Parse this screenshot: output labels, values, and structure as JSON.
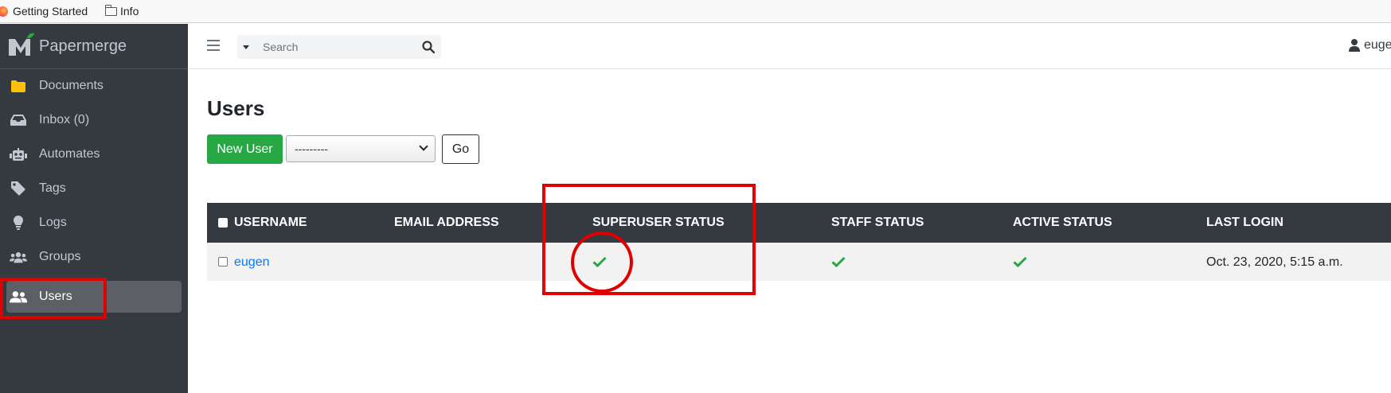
{
  "browser": {
    "bookmarks": [
      {
        "label": "Getting Started",
        "icon": "firefox-icon"
      },
      {
        "label": "Info",
        "icon": "folder-icon"
      }
    ]
  },
  "sidebar": {
    "brand": "Papermerge",
    "items": [
      {
        "label": "Documents",
        "icon": "folder-icon",
        "icon_color": "#ffc107"
      },
      {
        "label": "Inbox (0)",
        "icon": "inbox-icon"
      },
      {
        "label": "Automates",
        "icon": "robot-icon"
      },
      {
        "label": "Tags",
        "icon": "tag-icon"
      },
      {
        "label": "Logs",
        "icon": "lightbulb-icon"
      },
      {
        "label": "Groups",
        "icon": "users-group-icon"
      },
      {
        "label": "Users",
        "icon": "user-friends-icon",
        "active": true
      }
    ]
  },
  "topbar": {
    "search_placeholder": "Search",
    "user": "euge"
  },
  "page": {
    "title": "Users",
    "new_user_label": "New User",
    "action_select_value": "---------",
    "go_label": "Go"
  },
  "table": {
    "columns": [
      "USERNAME",
      "EMAIL ADDRESS",
      "SUPERUSER STATUS",
      "STAFF STATUS",
      "ACTIVE STATUS",
      "LAST LOGIN"
    ],
    "rows": [
      {
        "username": "eugen",
        "email": "",
        "superuser": true,
        "staff": true,
        "active": true,
        "last_login": "Oct. 23, 2020, 5:15 a.m."
      }
    ]
  },
  "colors": {
    "sidebar_bg": "#343a40",
    "accent_green": "#28a745",
    "link_blue": "#007bff",
    "annotation_red": "#e00000"
  }
}
